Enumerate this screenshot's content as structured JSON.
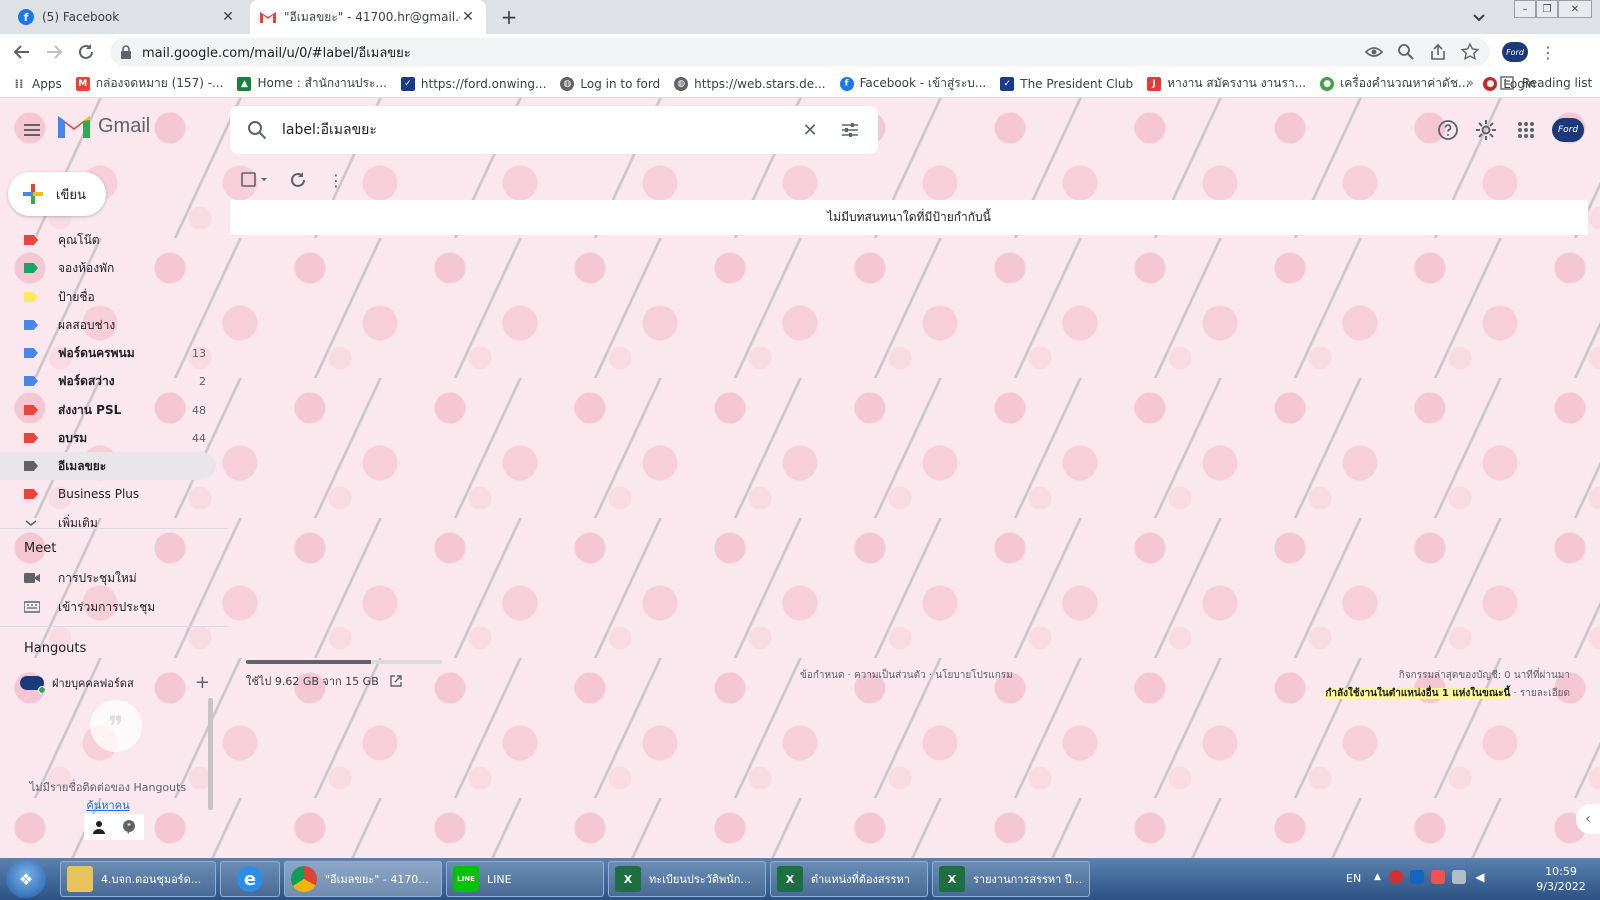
{
  "browser": {
    "tabs": [
      {
        "title": "(5) Facebook",
        "active": false,
        "icon": "facebook-icon"
      },
      {
        "title": "\"อีเมลขยะ\" - 41700.hr@gmail.com",
        "active": true,
        "icon": "gmail-icon"
      }
    ],
    "new_tab": "+",
    "url": "mail.google.com/mail/u/0/#label/อีเมลขยะ",
    "bookmarks": [
      {
        "label": "Apps",
        "icon": "apps-grid-icon",
        "color": "#5f6368"
      },
      {
        "label": "กล่องจดหมาย (157) -...",
        "icon": "gmail-icon",
        "color": "#ea4335"
      },
      {
        "label": "Home : สำนักงานประ...",
        "icon": "drive-icon",
        "color": "#188038"
      },
      {
        "label": "https://ford.onwing...",
        "icon": "checkbox-site-icon",
        "color": "#1a3b8c"
      },
      {
        "label": "Log in to ford",
        "icon": "globe-icon",
        "color": "#5f6368"
      },
      {
        "label": "https://web.stars.de...",
        "icon": "globe-icon",
        "color": "#5f6368"
      },
      {
        "label": "Facebook - เข้าสู่ระบ...",
        "icon": "facebook-icon",
        "color": "#1877f2"
      },
      {
        "label": "The President Club",
        "icon": "checkbox-site-icon",
        "color": "#1a3b8c"
      },
      {
        "label": "หางาน สมัครงาน งานรา...",
        "icon": "jobthai-icon",
        "color": "#e53935"
      },
      {
        "label": "เครื่องคำนวณหาค่าดัช...",
        "icon": "calculator-site-icon",
        "color": "#43a047"
      },
      {
        "label": "Login",
        "icon": "login-site-icon",
        "color": "#c62828"
      }
    ],
    "bookmarks_more": "»",
    "reading_list": "Reading list"
  },
  "gmail": {
    "app_name": "Gmail",
    "search_value": "label:อีเมลขยะ",
    "compose_label": "เขียน",
    "empty_message": "ไม่มีบทสนทนาใดที่มีป้ายกำกับนี้",
    "labels": [
      {
        "name": "คุณโน๊ต",
        "color": "#e8453c",
        "count": "",
        "bold": false,
        "selected": false
      },
      {
        "name": "จองห้องพัก",
        "color": "#16a765",
        "count": "",
        "bold": false,
        "selected": false
      },
      {
        "name": "ป้ายชื่อ",
        "color": "#fce864",
        "count": "",
        "bold": false,
        "selected": false
      },
      {
        "name": "ผลสอบช่าง",
        "color": "#4a86e8",
        "count": "",
        "bold": false,
        "selected": false
      },
      {
        "name": "ฟอร์ดนครพนม",
        "color": "#4a86e8",
        "count": "13",
        "bold": true,
        "selected": false
      },
      {
        "name": "ฟอร์ดสว่าง",
        "color": "#4a86e8",
        "count": "2",
        "bold": true,
        "selected": false
      },
      {
        "name": "ส่งงาน PSL",
        "color": "#e8453c",
        "count": "48",
        "bold": true,
        "selected": false
      },
      {
        "name": "อบรม",
        "color": "#e8453c",
        "count": "44",
        "bold": true,
        "selected": false
      },
      {
        "name": "อีเมลขยะ",
        "color": "#5f6368",
        "count": "",
        "bold": true,
        "selected": true
      },
      {
        "name": "Business Plus",
        "color": "#e8453c",
        "count": "",
        "bold": false,
        "selected": false
      }
    ],
    "more_label": "เพิ่มเติม",
    "meet": {
      "title": "Meet",
      "new_meeting": "การประชุมใหม่",
      "join_meeting": "เข้าร่วมการประชุม"
    },
    "hangouts": {
      "title": "Hangouts",
      "contact": "ฝ่ายบุคคลฟอร์ดส",
      "empty": "ไม่มีรายชื่อติดต่อของ Hangouts",
      "find": "ค้นหาคน"
    },
    "storage": {
      "text": "ใช้ไป 9.62 GB จาก 15 GB",
      "fraction": 0.64
    },
    "footer": {
      "links": "ข้อกำหนด · ความเป็นส่วนตัว · นโยบายโปรแกรม",
      "activity": "กิจกรรมล่าสุดของบัญชี: 0 นาทีที่ผ่านมา",
      "multi_session": "กำลังใช้งานในตำแหน่งอื่น 1 แห่งในขณะนี้",
      "details": " · รายละเอียด"
    }
  },
  "taskbar": {
    "items": [
      {
        "label": "4.บจก.ดอนชุมอร์ด...",
        "icon": "folder-icon",
        "color": "#e8c25a",
        "glyph": ""
      },
      {
        "label": "",
        "icon": "internet-explorer-icon",
        "color": "#2a8de8",
        "glyph": "e"
      },
      {
        "label": "\"อีเมลขยะ\" - 4170...",
        "icon": "chrome-icon",
        "color": "#db4437",
        "glyph": ""
      },
      {
        "label": "LINE",
        "icon": "line-icon",
        "color": "#00c300",
        "glyph": "LINE"
      },
      {
        "label": "ทะเบียนประวัติพนัก...",
        "icon": "excel-icon",
        "color": "#1d6f42",
        "glyph": "X"
      },
      {
        "label": "ตำแหน่งที่ต้องสรรหา",
        "icon": "excel-icon",
        "color": "#1d6f42",
        "glyph": "X"
      },
      {
        "label": "รายงานการสรรหา ปี...",
        "icon": "excel-icon",
        "color": "#1d6f42",
        "glyph": "X"
      }
    ],
    "language": "EN",
    "time": "10:59",
    "date": "9/3/2022"
  }
}
